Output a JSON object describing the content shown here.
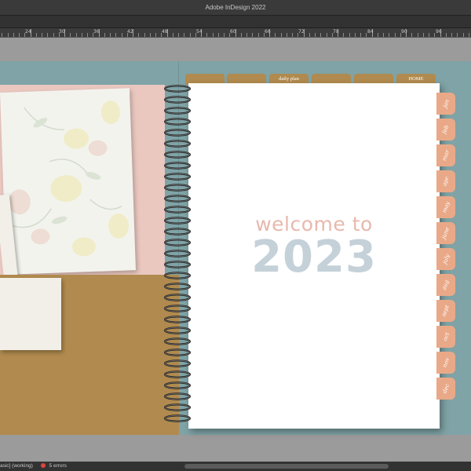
{
  "app": {
    "title": "Adobe InDesign 2022"
  },
  "ruler": {
    "labels": [
      "24",
      "30",
      "36",
      "42",
      "48",
      "54",
      "60",
      "66",
      "72",
      "78",
      "84",
      "90",
      "96"
    ]
  },
  "document": {
    "top_tabs": [
      "",
      "",
      "daily plan",
      "",
      "",
      "HOME"
    ],
    "side_tabs": [
      "jan",
      "feb",
      "mar",
      "apr",
      "may",
      "june",
      "july",
      "aug",
      "sept",
      "oct",
      "nov",
      "dec"
    ],
    "heading_line1": "welcome to",
    "heading_line2": "2023",
    "colors": {
      "teal": "#7fa3a6",
      "pink": "#eac8c0",
      "gold": "#b08a4e",
      "peach_tab": "#e9a988",
      "welcome_pink": "#e8b8ad",
      "year_blue": "#c5d1d9"
    }
  },
  "status": {
    "profile": "asic] (working)",
    "errors": "5 errors"
  },
  "icons": {
    "spiral": "spiral-binding",
    "error": "error-dot-icon"
  }
}
